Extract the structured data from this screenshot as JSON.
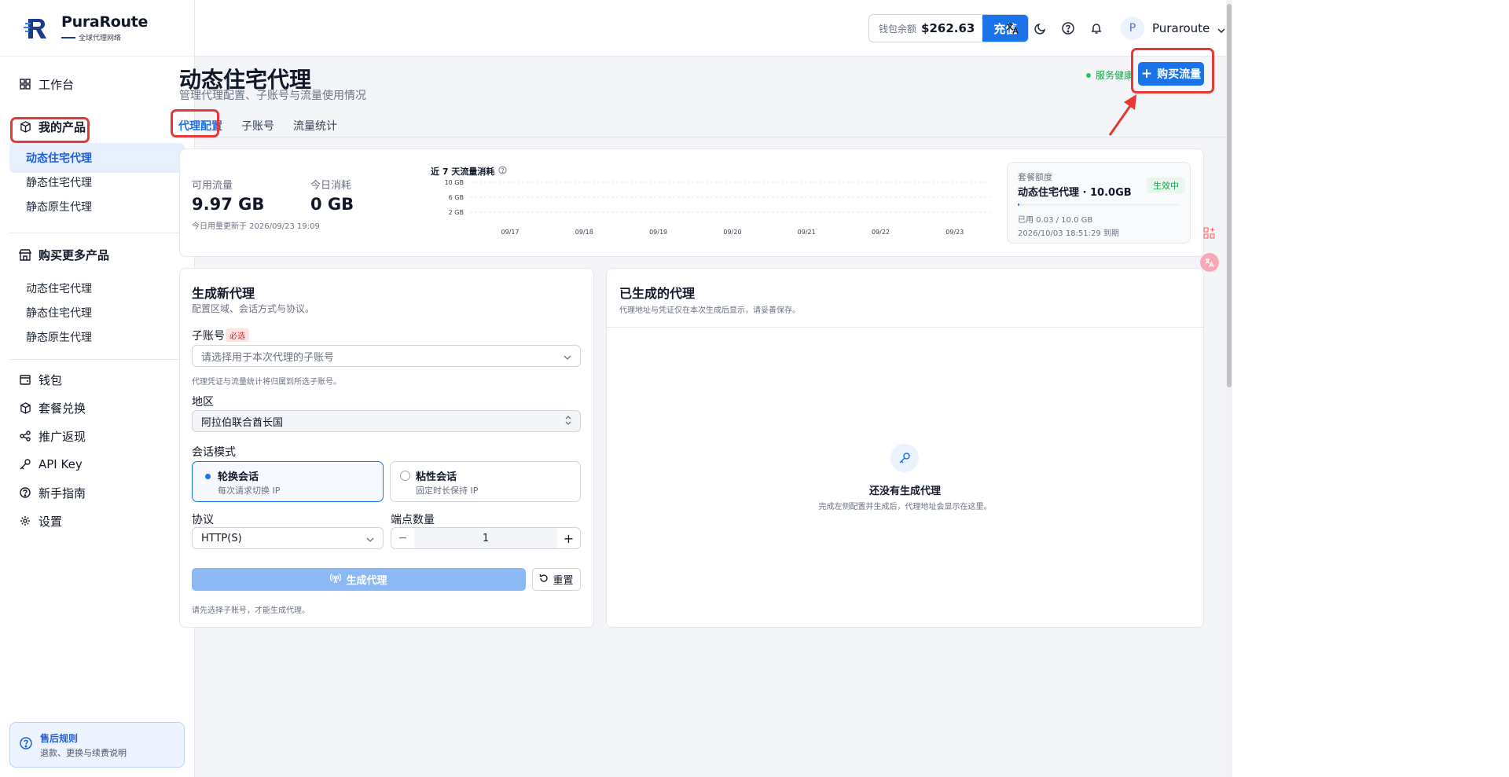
{
  "brand": {
    "name": "PuraRoute",
    "tagline": "全球代理网络"
  },
  "sidebar": {
    "workbench": "工作台",
    "my_products": "我的产品",
    "my_products_items": [
      "动态住宅代理",
      "静态住宅代理",
      "静态原生代理"
    ],
    "buy_more": "购买更多产品",
    "buy_more_items": [
      "动态住宅代理",
      "静态住宅代理",
      "静态原生代理"
    ],
    "bottom_items": [
      "钱包",
      "套餐兑换",
      "推广返现",
      "API Key",
      "新手指南",
      "设置"
    ],
    "help": {
      "title": "售后规则",
      "desc": "退款、更换与续费说明"
    }
  },
  "topbar": {
    "wallet_label": "钱包余额",
    "wallet_amount": "$262.63",
    "recharge": "充值",
    "avatar_letter": "P",
    "username": "Puraroute"
  },
  "page": {
    "title": "动态住宅代理",
    "subtitle": "管理代理配置、子账号与流量使用情况",
    "health": "服务健康",
    "buy_traffic": "购买流量",
    "tabs": [
      "代理配置",
      "子账号",
      "流量统计"
    ]
  },
  "stats": {
    "available_label": "可用流量",
    "available_value": "9.97 GB",
    "today_label": "今日消耗",
    "today_value": "0 GB",
    "updated": "今日用量更新于 2026/09/23 19:09"
  },
  "plan": {
    "label": "套餐额度",
    "name": "动态住宅代理 · 10.0GB",
    "status": "生效中",
    "used": "已用 0.03 / 10.0 GB",
    "used_fraction": 0.003,
    "expires": "2026/10/03 18:51:29 到期"
  },
  "chart_data": {
    "type": "line",
    "title": "近 7 天流量消耗",
    "categories": [
      "09/17",
      "09/18",
      "09/19",
      "09/20",
      "09/21",
      "09/22",
      "09/23"
    ],
    "yticks": [
      "10 GB",
      "6 GB",
      "2 GB"
    ],
    "series": [
      {
        "values": [
          0,
          0,
          0,
          0,
          0,
          0,
          0
        ]
      }
    ],
    "xlabel": "",
    "ylabel": "",
    "grid": true
  },
  "form": {
    "title": "生成新代理",
    "subtitle": "配置区域、会话方式与协议。",
    "subaccount_label": "子账号",
    "required": "必选",
    "subaccount_placeholder": "请选择用于本次代理的子账号",
    "subaccount_hint": "代理凭证与流量统计将归属到所选子账号。",
    "region_label": "地区",
    "region_value": "阿拉伯联合酋长国",
    "session_label": "会话模式",
    "session_rotate": "轮换会话",
    "session_rotate_desc": "每次请求切换 IP",
    "session_sticky": "粘性会话",
    "session_sticky_desc": "固定时长保持 IP",
    "protocol_label": "协议",
    "protocol_value": "HTTP(S)",
    "ports_label": "端点数量",
    "ports_value": "1",
    "minus": "−",
    "plus": "+",
    "generate": "生成代理",
    "reset": "重置",
    "footer_hint": "请先选择子账号，才能生成代理。"
  },
  "generated": {
    "title": "已生成的代理",
    "subtitle": "代理地址与凭证仅在本次生成后显示，请妥善保存。",
    "empty_title": "还没有生成代理",
    "empty_desc": "完成左侧配置并生成后，代理地址会显示在这里。"
  },
  "colors": {
    "accent": "#1a73e8",
    "annotation": "#e53935",
    "success": "#16a34a"
  }
}
